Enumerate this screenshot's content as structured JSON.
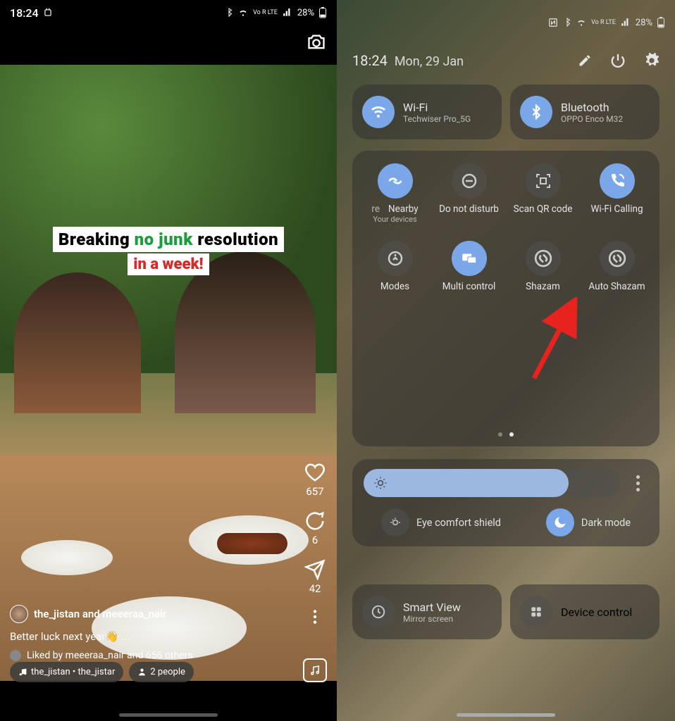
{
  "left": {
    "status": {
      "time": "18:24",
      "battery": "28%",
      "net": "Vo R LTE"
    },
    "caption": {
      "w1": "Breaking",
      "w2": "no junk",
      "w3": "resolution",
      "line2": "in a week!"
    },
    "right_icons": {
      "likes": "657",
      "comments": "6",
      "shares": "42"
    },
    "user_row": {
      "users": "the_jistan and meeeraa_nair"
    },
    "caption_text": "Better luck next year👋 ...",
    "liked_by": "Liked by meeeraa_nair and 656 others",
    "music_pill": "the_jistan • the_jistar",
    "people_pill": "2 people"
  },
  "right": {
    "status": {
      "battery": "28%",
      "net": "Vo R LTE"
    },
    "header": {
      "time": "18:24",
      "date": "Mon, 29 Jan"
    },
    "wifi": {
      "title": "Wi-Fi",
      "sub": "Techwiser Pro_5G"
    },
    "bluetooth": {
      "title": "Bluetooth",
      "sub": "OPPO Enco M32"
    },
    "tiles": {
      "nearby": "Nearby",
      "nearby_sub": "Your devices",
      "nearby_prefix": "re",
      "dnd": "Do not disturb",
      "qr": "Scan QR code",
      "wificall": "Wi-Fi Calling",
      "modes": "Modes",
      "multi": "Multi control",
      "shazam": "Shazam",
      "autoshazam": "Auto Shazam"
    },
    "eye": "Eye comfort shield",
    "dark": "Dark mode",
    "smartview": {
      "title": "Smart View",
      "sub": "Mirror screen"
    },
    "devctrl": "Device control"
  }
}
